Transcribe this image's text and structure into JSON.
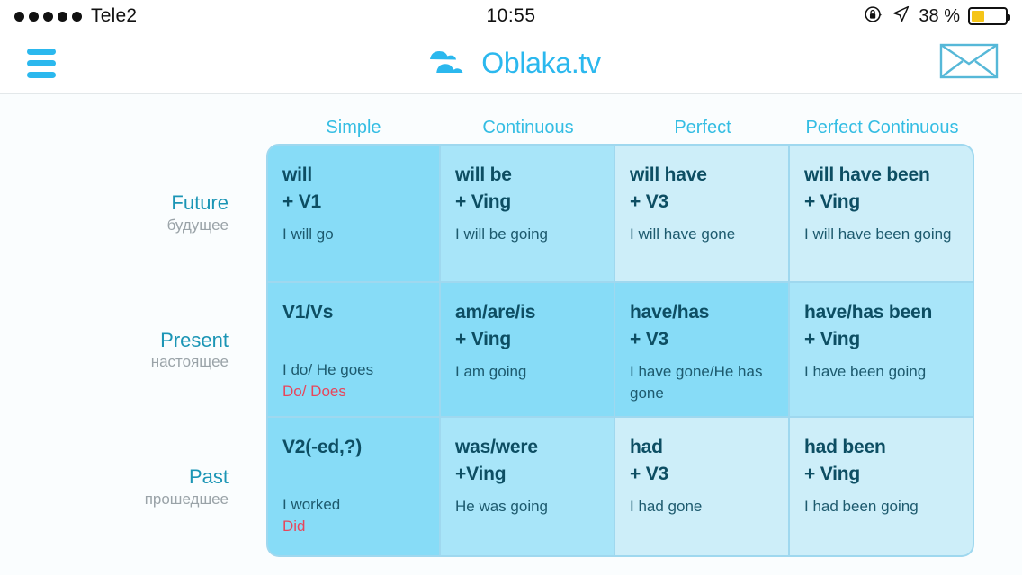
{
  "status_bar": {
    "signal_dots": 5,
    "carrier": "Tele2",
    "time": "10:55",
    "battery_percent": "38 %",
    "battery_level": 38,
    "icons": [
      "rotation-lock-icon",
      "location-arrow-icon",
      "battery-icon"
    ],
    "colors": {
      "battery_fill": "#f5c518",
      "text": "#111111"
    }
  },
  "header": {
    "menu_icon": "hamburger-menu-icon",
    "brand_name": "Oblaka.tv",
    "brand_icon": "cloud-logo-icon",
    "mail_icon": "envelope-icon",
    "colors": {
      "brand": "#2bb8ee"
    }
  },
  "table": {
    "column_headers": [
      "Simple",
      "Continuous",
      "Perfect",
      "Perfect Continuous"
    ],
    "rows": [
      {
        "label_en": "Future",
        "label_ru": "будущее",
        "cells": [
          {
            "formula_1": "will",
            "formula_2": "+ V1",
            "example": "I will go",
            "negative": ""
          },
          {
            "formula_1": "will be",
            "formula_2": "+ Ving",
            "example": "I will be going",
            "negative": ""
          },
          {
            "formula_1": "will have",
            "formula_2": "+ V3",
            "example": "I will have gone",
            "negative": ""
          },
          {
            "formula_1": "will have been",
            "formula_2": "+ Ving",
            "example": "I will have been going",
            "negative": ""
          }
        ]
      },
      {
        "label_en": "Present",
        "label_ru": "настоящее",
        "cells": [
          {
            "formula_1": "V1/Vs",
            "formula_2": "",
            "example": "I do/ He goes",
            "negative": "Do/ Does"
          },
          {
            "formula_1": "am/are/is",
            "formula_2": "+ Ving",
            "example": "I am going",
            "negative": ""
          },
          {
            "formula_1": "have/has",
            "formula_2": "+ V3",
            "example": "I have gone/He has gone",
            "negative": ""
          },
          {
            "formula_1": "have/has been",
            "formula_2": "+ Ving",
            "example": "I have been going",
            "negative": ""
          }
        ]
      },
      {
        "label_en": "Past",
        "label_ru": "прошедшее",
        "cells": [
          {
            "formula_1": "V2(-ed,?)",
            "formula_2": "",
            "example": "I worked",
            "negative": "Did"
          },
          {
            "formula_1": "was/were",
            "formula_2": "+Ving",
            "example": "He was going",
            "negative": ""
          },
          {
            "formula_1": "had",
            "formula_2": "+ V3",
            "example": "I had gone",
            "negative": ""
          },
          {
            "formula_1": "had been",
            "formula_2": "+ Ving",
            "example": "I had been going",
            "negative": ""
          }
        ]
      }
    ],
    "colors": {
      "header_text": "#34bde3",
      "row_label_en": "#1b95b5",
      "row_label_ru": "#9aa3a8",
      "formula_text": "#0d4e63",
      "example_text": "#1d5a6e",
      "negative_text": "#e8455b",
      "border": "#9fd8ef",
      "tint_simple_strong": "#87dcf7",
      "tint_medium": "#a8e5f9",
      "tint_light": "#cdeef9"
    }
  }
}
